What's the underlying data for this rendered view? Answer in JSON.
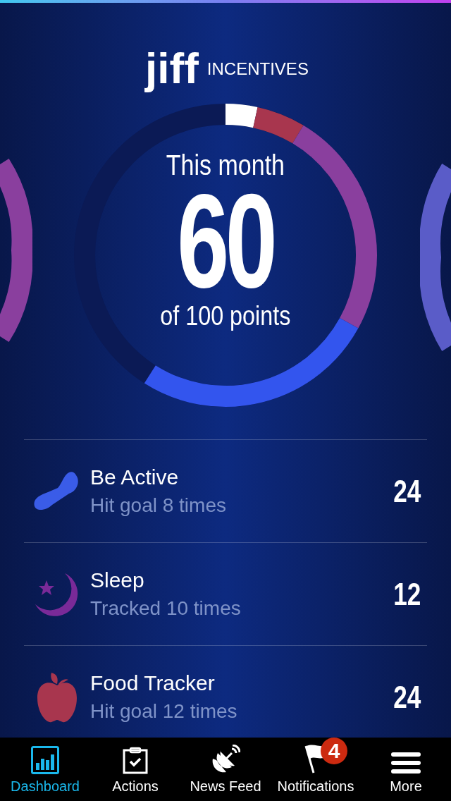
{
  "logo": {
    "wordmark": "jiff",
    "label": "INCENTIVES"
  },
  "meter": {
    "title": "This month",
    "value": "60",
    "subtitle": "of 100 points"
  },
  "activities": [
    {
      "kind": "foot",
      "color": "#3a5ce8",
      "title": "Be Active",
      "detail": "Hit goal 8 times",
      "points": "24"
    },
    {
      "kind": "moon",
      "color": "#7a2a98",
      "title": "Sleep",
      "detail": "Tracked 10 times",
      "points": "12"
    },
    {
      "kind": "apple",
      "color": "#a8364e",
      "title": "Food Tracker",
      "detail": "Hit goal 12 times",
      "points": "24"
    }
  ],
  "tabs": [
    {
      "kind": "dashboard",
      "label": "Dashboard",
      "selected": true
    },
    {
      "kind": "actions",
      "label": "Actions",
      "selected": false
    },
    {
      "kind": "news",
      "label": "News Feed",
      "selected": false
    },
    {
      "kind": "notifications",
      "label": "Notifications",
      "selected": false,
      "badge": "4"
    },
    {
      "kind": "more",
      "label": "More",
      "selected": false
    }
  ]
}
